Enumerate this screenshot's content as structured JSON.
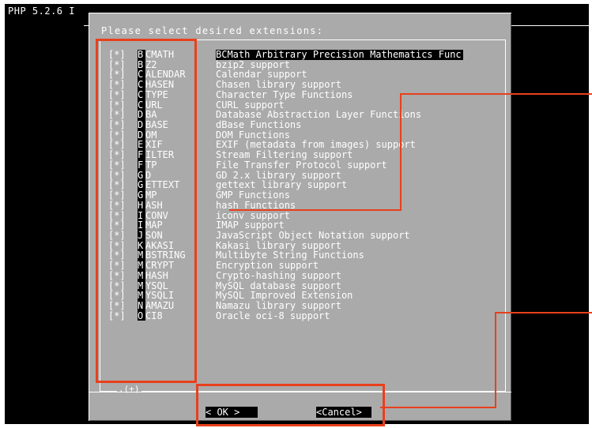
{
  "window": {
    "title": "PHP 5.2.6 I"
  },
  "dialog": {
    "prompt": "Please select desired extensions:",
    "more_indicator": ".(+)",
    "ok_label": "<  OK  >",
    "cancel_label": "<Cancel>"
  },
  "extensions": [
    {
      "check": "[*]",
      "name": "BCMATH",
      "desc": "BCMath Arbitrary Precision Mathematics Func"
    },
    {
      "check": "[*]",
      "name": "BZ2",
      "desc": "bzip2 support"
    },
    {
      "check": "[*]",
      "name": "CALENDAR",
      "desc": "Calendar support"
    },
    {
      "check": "[*]",
      "name": "CHASEN",
      "desc": "Chasen library support"
    },
    {
      "check": "[*]",
      "name": "CTYPE",
      "desc": "Character Type Functions"
    },
    {
      "check": "[*]",
      "name": "CURL",
      "desc": "CURL support"
    },
    {
      "check": "[*]",
      "name": "DBA",
      "desc": "Database Abstraction Layer Functions"
    },
    {
      "check": "[*]",
      "name": "DBASE",
      "desc": "dBase Functions"
    },
    {
      "check": "[*]",
      "name": "DOM",
      "desc": "DOM Functions"
    },
    {
      "check": "[*]",
      "name": "EXIF",
      "desc": "EXIF (metadata from images) support"
    },
    {
      "check": "[*]",
      "name": "FILTER",
      "desc": "Stream Filtering support"
    },
    {
      "check": "[*]",
      "name": "FTP",
      "desc": "File Transfer Protocol support"
    },
    {
      "check": "[*]",
      "name": "GD",
      "desc": "GD 2.x library support"
    },
    {
      "check": "[*]",
      "name": "GETTEXT",
      "desc": "gettext library support"
    },
    {
      "check": "[*]",
      "name": "GMP",
      "desc": "GMP Functions"
    },
    {
      "check": "[*]",
      "name": "HASH",
      "desc": "hash Functions"
    },
    {
      "check": "[*]",
      "name": "ICONV",
      "desc": "iconv support"
    },
    {
      "check": "[*]",
      "name": "IMAP",
      "desc": "IMAP support"
    },
    {
      "check": "[*]",
      "name": "JSON",
      "desc": "JavaScript Object Notation support"
    },
    {
      "check": "[*]",
      "name": "KAKASI",
      "desc": "Kakasi library support"
    },
    {
      "check": "[*]",
      "name": "MBSTRING",
      "desc": "Multibyte String Functions"
    },
    {
      "check": "[*]",
      "name": "MCRYPT",
      "desc": "Encryption support"
    },
    {
      "check": "[*]",
      "name": "MHASH",
      "desc": "Crypto-hashing support"
    },
    {
      "check": "[*]",
      "name": "MYSQL",
      "desc": "MySQL database support"
    },
    {
      "check": "[*]",
      "name": "MYSQLI",
      "desc": "MySQL Improved Extension"
    },
    {
      "check": "[*]",
      "name": "NAMAZU",
      "desc": "Namazu library support"
    },
    {
      "check": "[*]",
      "name": "OCI8",
      "desc": "Oracle oci-8 support"
    }
  ],
  "colors": {
    "terminal_bg": "#000000",
    "dialog_bg": "#aaaaaa",
    "annotation": "#e8401c"
  }
}
